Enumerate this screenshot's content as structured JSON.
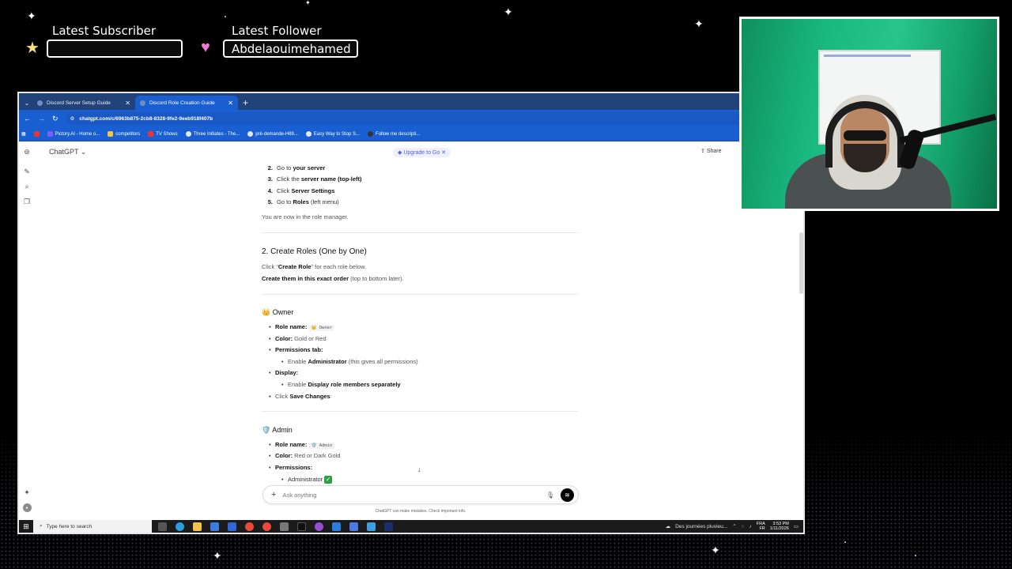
{
  "overlay": {
    "subscriber_title": "Latest Subscriber",
    "subscriber_value": "",
    "follower_title": "Latest Follower",
    "follower_value": "Abdelaouimehamed"
  },
  "browser": {
    "tabs": [
      {
        "label": "Discord Server Setup Guide",
        "active": false
      },
      {
        "label": "Discord Role Creation Guide",
        "active": true
      }
    ],
    "url": "chatgpt.com/c/6963b875-2cb8-8328-9fe2-9eeb918f407b",
    "bookmarks": [
      "Pictory.AI - Home o...",
      "competitors",
      "TV Shows",
      "Three Initiates - The...",
      "pré-demande-H69...",
      "Easy Way to Stop S...",
      "Follow me descripti..."
    ]
  },
  "app": {
    "title": "ChatGPT",
    "upgrade_label": "Upgrade to Go",
    "share_label": "Share",
    "composer_placeholder": "Ask anything",
    "disclaimer": "ChatGPT can make mistakes. Check important info."
  },
  "doc": {
    "steps": [
      {
        "num": "2.",
        "pre": "Go to ",
        "bold": "your server",
        "post": ""
      },
      {
        "num": "3.",
        "pre": "Click the ",
        "bold": "server name (top-left)",
        "post": ""
      },
      {
        "num": "4.",
        "pre": "Click ",
        "bold": "Server Settings",
        "post": ""
      },
      {
        "num": "5.",
        "pre": "Go to ",
        "bold": "Roles",
        "post": " (left menu)"
      }
    ],
    "role_manager_note": "You are now in the role manager.",
    "section_title": "2. Create Roles (One by One)",
    "click_pre": "Click “",
    "click_bold": "Create Role",
    "click_post": "” for each role below.",
    "order_bold": "Create them in this exact order",
    "order_post": " (top to bottom later).",
    "owner": {
      "emoji": "👑",
      "title": "Owner",
      "role_name_label": "Role name:",
      "role_name_code": "👑 Owner",
      "color_label": "Color:",
      "color_value": " Gold or Red",
      "permissions_label": "Permissions tab:",
      "perm_pre": "Enable ",
      "perm_bold": "Administrator",
      "perm_post": " (this gives all permissions)",
      "display_label": "Display:",
      "display_pre": "Enable ",
      "display_bold": "Display role members separately",
      "save_pre": "Click ",
      "save_bold": "Save Changes"
    },
    "admin": {
      "emoji": "🛡️",
      "title": "Admin",
      "role_name_label": "Role name:",
      "role_name_code": "🛡️ Admin",
      "color_label": "Color:",
      "color_value": " Red or Dark Gold",
      "permissions_label": "Permissions:",
      "perm_item": "Administrator",
      "perm_check": "✓"
    }
  },
  "taskbar": {
    "search_placeholder": "Type here to search",
    "weather": "Des journées pluvieu...",
    "lang": "FRA",
    "region": "FR",
    "time": "3:53 PM",
    "date": "1/11/2026"
  },
  "colors": {
    "tab_bar": "#22437a",
    "browser_chrome": "#1a5fd1",
    "page_bg": "#ffffff",
    "greenscreen": "#19b880"
  }
}
